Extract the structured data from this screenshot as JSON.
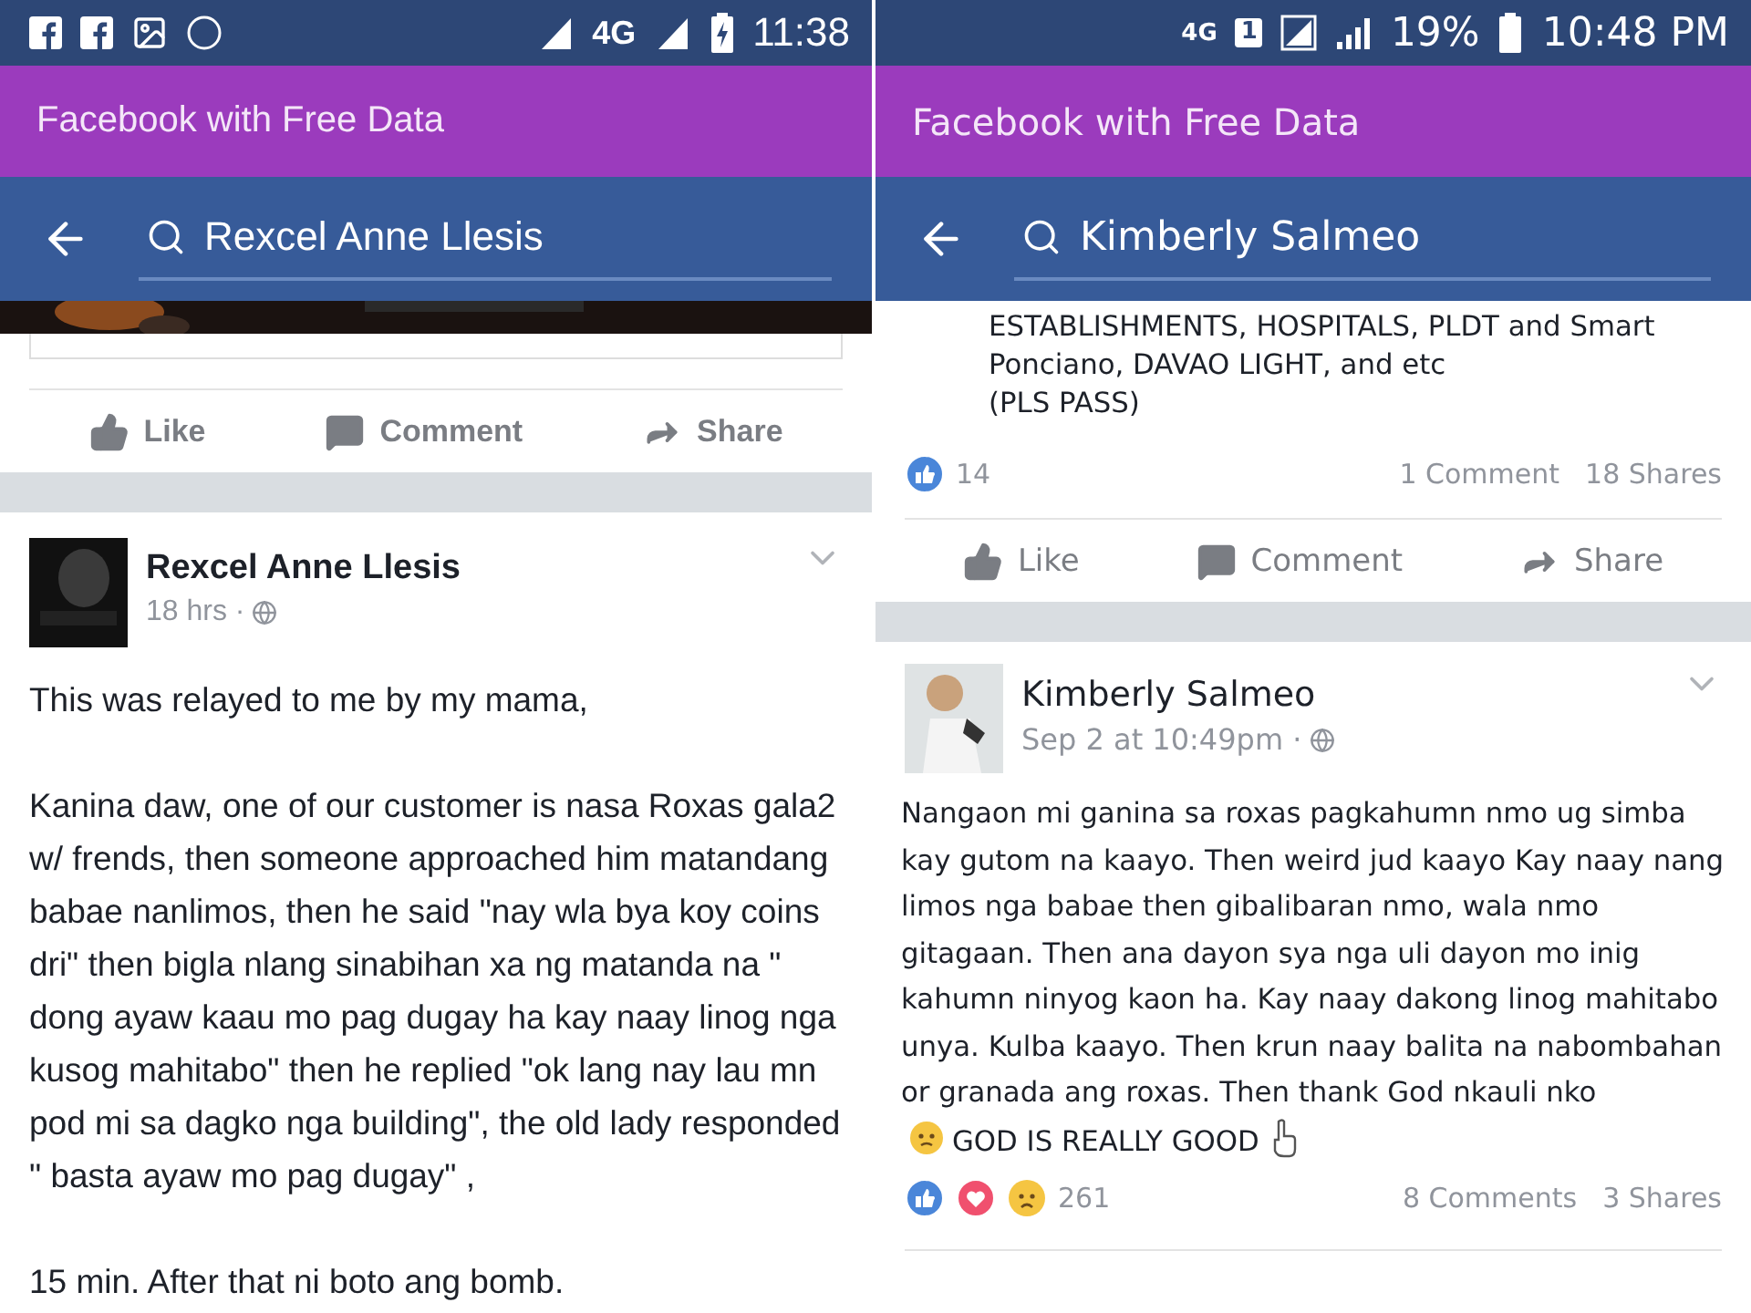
{
  "panels": [
    {
      "kind": "stock",
      "status_bar": {
        "network": "4G",
        "clock": "11:38"
      },
      "app_banner": "Facebook with Free Data",
      "search": {
        "value": "Rexcel Anne Llesis"
      },
      "feed": [
        {
          "media": {
            "kind": "picture"
          },
          "actions": [
            "Like",
            "Comment",
            "Share"
          ]
        },
        {
          "author": "Rexcel Anne Llesis",
          "time": "18 hrs ·",
          "body": [
            [
              {
                "kind": "text",
                "text": "This was relayed to me by my mama,"
              }
            ],
            [
              {
                "kind": "text",
                "text": "Kanina daw, one of our customer is nasa Roxas gala2 w/ frends, then someone approached him matandang babae nanlimos, then he said \"nay wla bya koy coins dri\" then bigla nlang sinabihan xa ng matanda na \" dong ayaw kaau mo pag dugay ha kay naay linog nga kusog mahitabo\" then he replied \"ok lang nay lau mn pod mi sa dagko nga building\", the old lady responded \" basta ayaw mo pag dugay\" ,"
              }
            ],
            [
              {
                "kind": "text",
                "text": "15 min. After that ni boto ang bomb."
              }
            ]
          ]
        }
      ]
    },
    {
      "kind": "samsung",
      "status_bar": {
        "network": "4G",
        "sim": "1",
        "battery": "19%",
        "clock": "10:48 PM"
      },
      "app_banner": "Facebook with Free Data",
      "search": {
        "value": "Kimberly Salmeo"
      },
      "feed": [
        {
          "body": [
            [
              {
                "kind": "text",
                "text": "ESTABLISHMENTS, HOSPITALS, PLDT and Smart\nPonciano, DAVAO LIGHT, and etc\n(PLS PASS)"
              }
            ]
          ],
          "stats": {
            "kind": "single",
            "count": "14",
            "comments": "1 Comment",
            "shares": "18 Shares"
          },
          "actions": [
            "Like",
            "Comment",
            "Share"
          ]
        },
        {
          "author": "Kimberly Salmeo",
          "time": "Sep 2 at 10:49pm ·",
          "body": [
            [
              {
                "kind": "text",
                "text": "Nangaon mi ganina sa roxas pagkahumn nmo ug simba kay gutom na kaayo. Then weird jud kaayo  Kay naay nang limos nga babae then gibalibaran nmo, wala nmo gitagaan. Then ana dayon sya nga uli dayon mo inig kahumn ninyog kaon ha. Kay naay dakong linog mahitabo unya. Kulba kaayo. Then krun naay balita na nabombahan or granada ang roxas. Then thank God nkauli nko"
              },
              {
                "kind": "face"
              },
              {
                "kind": "text",
                "text": "GOD IS REALLY GOOD"
              },
              {
                "kind": "hand"
              }
            ]
          ],
          "stats": {
            "kind": "triple",
            "count": "261",
            "comments": "8 Comments",
            "shares": "3 Shares"
          }
        }
      ]
    }
  ]
}
